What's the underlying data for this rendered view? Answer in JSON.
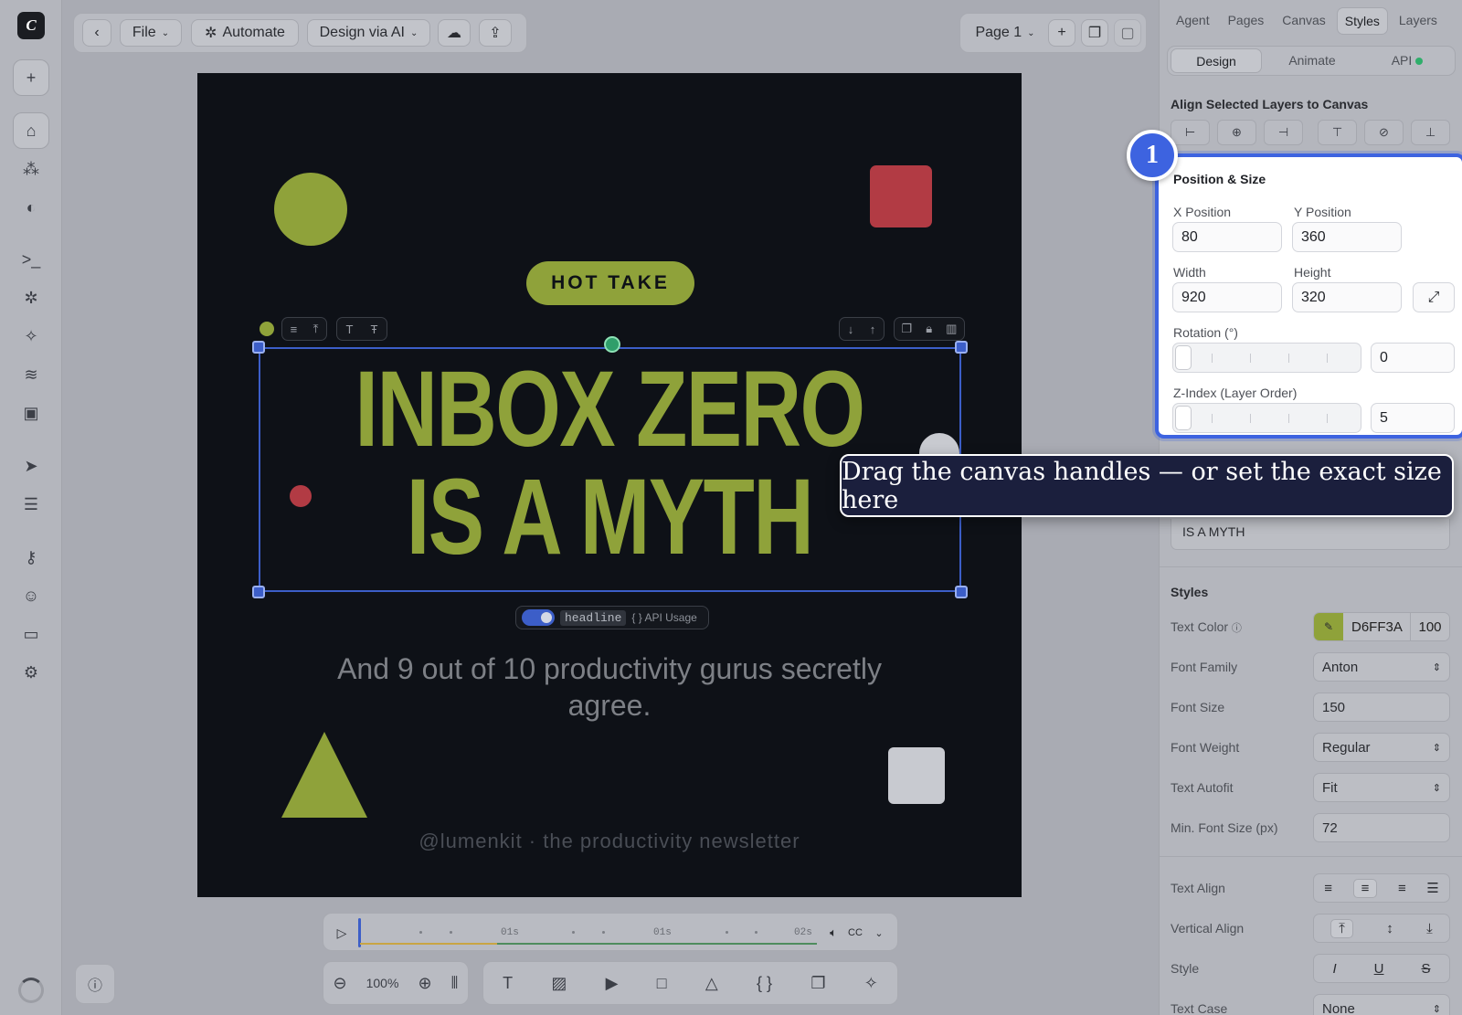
{
  "toolbar": {
    "file": "File",
    "automate": "Automate",
    "design_ai": "Design via AI",
    "page": "Page 1"
  },
  "canvas": {
    "badge": "HOT TAKE",
    "headline_line1": "INBOX ZERO",
    "headline_line2": "IS A MYTH",
    "subtitle": "And 9 out of 10 productivity gurus secretly agree.",
    "footer": "@lumenkit · the productivity newsletter",
    "layer_tag": "headline",
    "api_usage": "{ } API Usage",
    "colors": {
      "accent": "#8fa23a",
      "red": "#b23b44",
      "bg": "#0e1117",
      "light": "#c8cad0"
    }
  },
  "timeline": {
    "labels": [
      "01s",
      "01s",
      "02s"
    ]
  },
  "zoom": {
    "level": "100%"
  },
  "panel": {
    "tabs": [
      "Agent",
      "Pages",
      "Canvas",
      "Styles",
      "Layers"
    ],
    "subtabs": [
      "Design",
      "Animate",
      "API"
    ],
    "align_title": "Align Selected Layers to Canvas",
    "position": {
      "title": "Position & Size",
      "x_label": "X Position",
      "x": "80",
      "y_label": "Y Position",
      "y": "360",
      "w_label": "Width",
      "w": "920",
      "h_label": "Height",
      "h": "320",
      "rot_label": "Rotation (°)",
      "rot": "0",
      "z_label": "Z-Index (Layer Order)",
      "z": "5"
    },
    "text_tail": "IS A MYTH",
    "styles_title": "Styles",
    "text_color_label": "Text Color",
    "text_color": "D6FF3A",
    "text_opacity": "100",
    "font_family_label": "Font Family",
    "font_family": "Anton",
    "font_size_label": "Font Size",
    "font_size": "150",
    "font_weight_label": "Font Weight",
    "font_weight": "Regular",
    "autofit_label": "Text Autofit",
    "autofit": "Fit",
    "min_font_label": "Min. Font Size (px)",
    "min_font": "72",
    "text_align_label": "Text Align",
    "valign_label": "Vertical Align",
    "style_label": "Style",
    "text_case_label": "Text Case",
    "text_case": "None"
  },
  "callout": {
    "number": "1",
    "tooltip": "Drag the canvas handles — or set the exact size here"
  }
}
